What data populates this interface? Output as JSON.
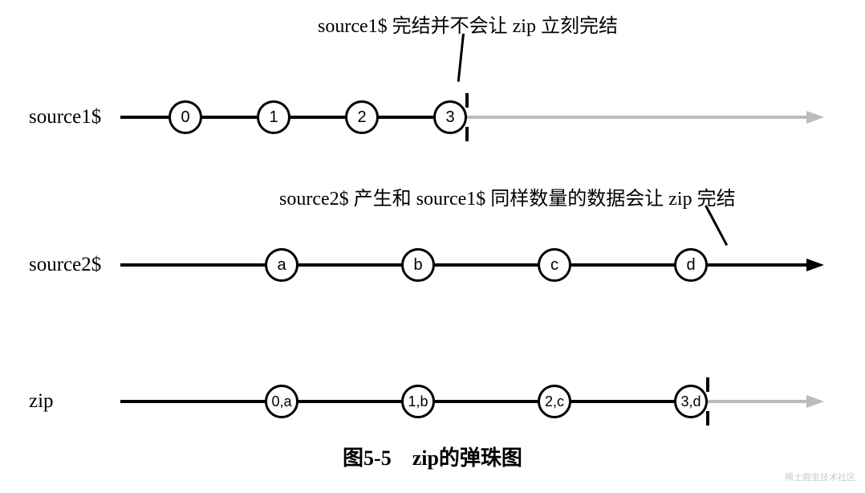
{
  "chart_data": {
    "type": "diagram",
    "description": "RxJS zip marble diagram",
    "streams": {
      "source1": {
        "label": "source1$",
        "events": [
          {
            "t": 0,
            "v": "0"
          },
          {
            "t": 1,
            "v": "1"
          },
          {
            "t": 2,
            "v": "2"
          },
          {
            "t": 3,
            "v": "3"
          }
        ],
        "complete_after": 3
      },
      "source2": {
        "label": "source2$",
        "events": [
          {
            "t": 0,
            "v": "a"
          },
          {
            "t": 1,
            "v": "b"
          },
          {
            "t": 2,
            "v": "c"
          },
          {
            "t": 3,
            "v": "d"
          }
        ]
      },
      "zip": {
        "label": "zip",
        "events": [
          {
            "t": 0,
            "v": "0,a"
          },
          {
            "t": 1,
            "v": "1,b"
          },
          {
            "t": 2,
            "v": "2,c"
          },
          {
            "t": 3,
            "v": "3,d"
          }
        ],
        "complete_after": 3
      }
    }
  },
  "notes": {
    "note1": "source1$ 完结并不会让 zip 立刻完结",
    "note2": "source2$ 产生和 source1$ 同样数量的数据会让 zip 完结"
  },
  "labels": {
    "source1": "source1$",
    "source2": "source2$",
    "zip": "zip"
  },
  "marbles": {
    "s1_0": "0",
    "s1_1": "1",
    "s1_2": "2",
    "s1_3": "3",
    "s2_a": "a",
    "s2_b": "b",
    "s2_c": "c",
    "s2_d": "d",
    "z_0": "0,a",
    "z_1": "1,b",
    "z_2": "2,c",
    "z_3": "3,d"
  },
  "caption": "图5-5　zip的弹珠图",
  "watermark": "稀土掘金技术社区"
}
